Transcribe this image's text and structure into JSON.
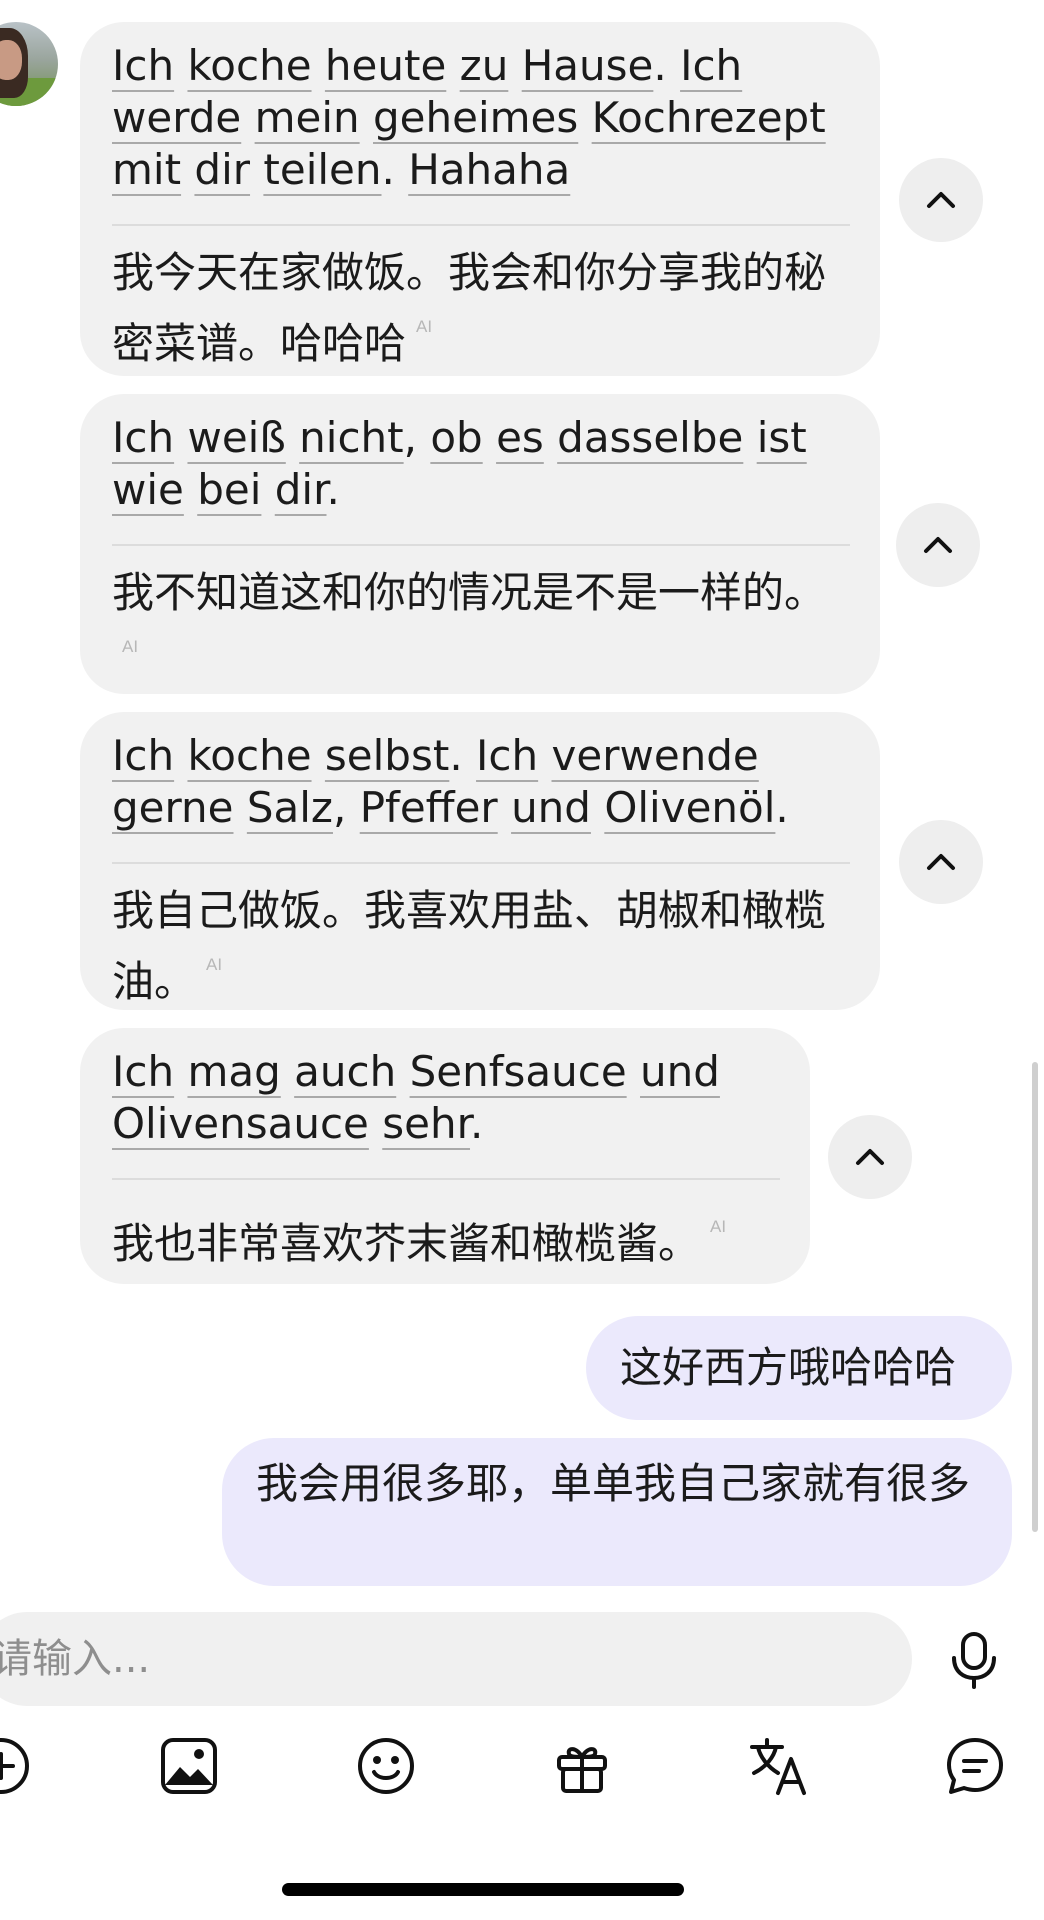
{
  "messages": [
    {
      "original": "Ich koche heute zu Hause. Ich werde mein geheimes Kochrezept mit dir teilen. Hahaha",
      "translation": "我今天在家做饭。我会和你分享我的秘密菜谱。哈哈哈",
      "badge": "AI"
    },
    {
      "original": "Ich weiß nicht, ob es dasselbe ist wie bei dir.",
      "translation": "我不知道这和你的情况是不是一样的。",
      "badge": "AI"
    },
    {
      "original": "Ich koche selbst. Ich verwende gerne Salz, Pfeffer und Olivenöl.",
      "translation": "我自己做饭。我喜欢用盐、胡椒和橄榄油。",
      "badge": "AI"
    },
    {
      "original": "Ich mag auch Senfsauce und Olivensauce sehr.",
      "translation": "我也非常喜欢芥末酱和橄榄酱。",
      "badge": "AI"
    }
  ],
  "my_messages": [
    "这好西方哦哈哈哈",
    "我会用很多耶，单单我自己家就有很多"
  ],
  "input": {
    "placeholder": "请输入..."
  },
  "toolbar": [
    "plus-icon",
    "image-icon",
    "emoji-icon",
    "gift-icon",
    "translate-icon",
    "chat-bubble-icon"
  ],
  "colors": {
    "incoming_bubble": "#f1f1f1",
    "outgoing_bubble": "#ebe9fc",
    "ai_badge": "#b7b7b7"
  }
}
